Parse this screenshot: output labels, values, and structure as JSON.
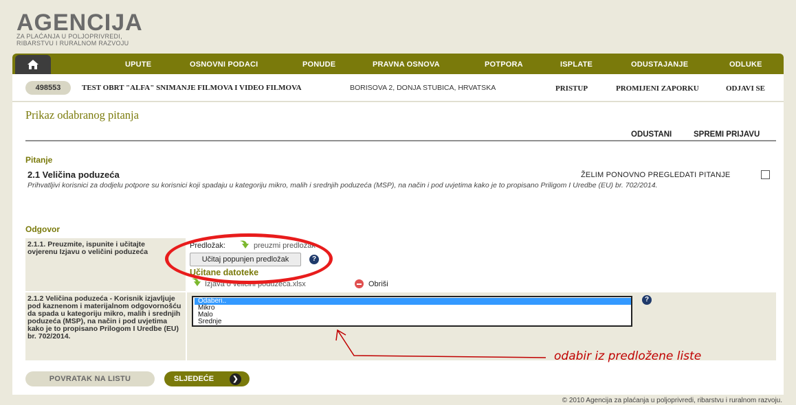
{
  "logo": {
    "title": "AGENCIJA",
    "subtitle_line1": "ZA PLAĆANJA U POLJOPRIVREDI,",
    "subtitle_line2": "RIBARSTVU I RURALNOM RAZVOJU"
  },
  "nav": {
    "home_icon": "home-icon",
    "items": [
      "UPUTE",
      "OSNOVNI PODACI",
      "PONUDE",
      "PRAVNA OSNOVA",
      "POTPORA",
      "ISPLATE",
      "ODUSTAJANJE",
      "ODLUKE"
    ]
  },
  "user": {
    "id": "498553",
    "name": "TEST OBRT \"ALFA\" SNIMANJE FILMOVA I VIDEO FILMOVA",
    "address": "BORISOVA 2, DONJA STUBICA, HRVATSKA",
    "links": [
      "PRISTUP",
      "PROMIJENI ZAPORKU",
      "ODJAVI SE"
    ]
  },
  "page": {
    "title": "Prikaz odabranog pitanja",
    "actions": [
      "ODUSTANI",
      "SPREMI PRIJAVU"
    ]
  },
  "question": {
    "section_label": "Pitanje",
    "title": "2.1 Veličina poduzeća",
    "review_label": "ŽELIM PONOVNO PREGLEDATI PITANJE",
    "review_checked": false,
    "description": "Prihvatljivi korisnici za dodjelu potpore su korisnici koji spadaju u kategoriju mikro, malih i srednjih poduzeća (MSP), na način i pod uvjetima kako je to propisano Priligom I Uredbe (EU) br. 702/2014."
  },
  "answer": {
    "section_label": "Odgovor",
    "row1": {
      "label": "2.1.1. Preuzmite, ispunite i učitajte ovjerenu Izjavu o veličini poduzeća",
      "template_label": "Predložak:",
      "template_link": "preuzmi predložak",
      "upload_button": "Učitaj popunjen predložak",
      "loaded_heading": "Učitane datoteke",
      "file_name": "Izjava o veličini poduzeća.xlsx",
      "delete_label": "Obriši"
    },
    "row2": {
      "label": "2.1.2 Veličina poduzeća - Korisnik izjavljuje pod kaznenom i materijalnom odgovornošću da spada u kategoriju mikro, malih i srednjih poduzeća (MSP), na način i pod uvjetima kako je to propisano Prilogom I Uredbe (EU) br. 702/2014.",
      "options": [
        "Odaberi..",
        "Mikro",
        "Malo",
        "Srednje"
      ],
      "selected": "Odaberi.."
    }
  },
  "annotation": {
    "text": "odabir iz predložene liste",
    "color": "#c00000"
  },
  "buttons": {
    "back": "POVRATAK NA LISTU",
    "next": "SLJEDEĆE"
  },
  "footer": "© 2010 Agencija za plaćanja u poljoprivredi, ribarstvu i ruralnom razvoju.",
  "colors": {
    "brand": "#7a7a0b",
    "background": "#ebe9dc",
    "highlight": "#e81c1c"
  }
}
